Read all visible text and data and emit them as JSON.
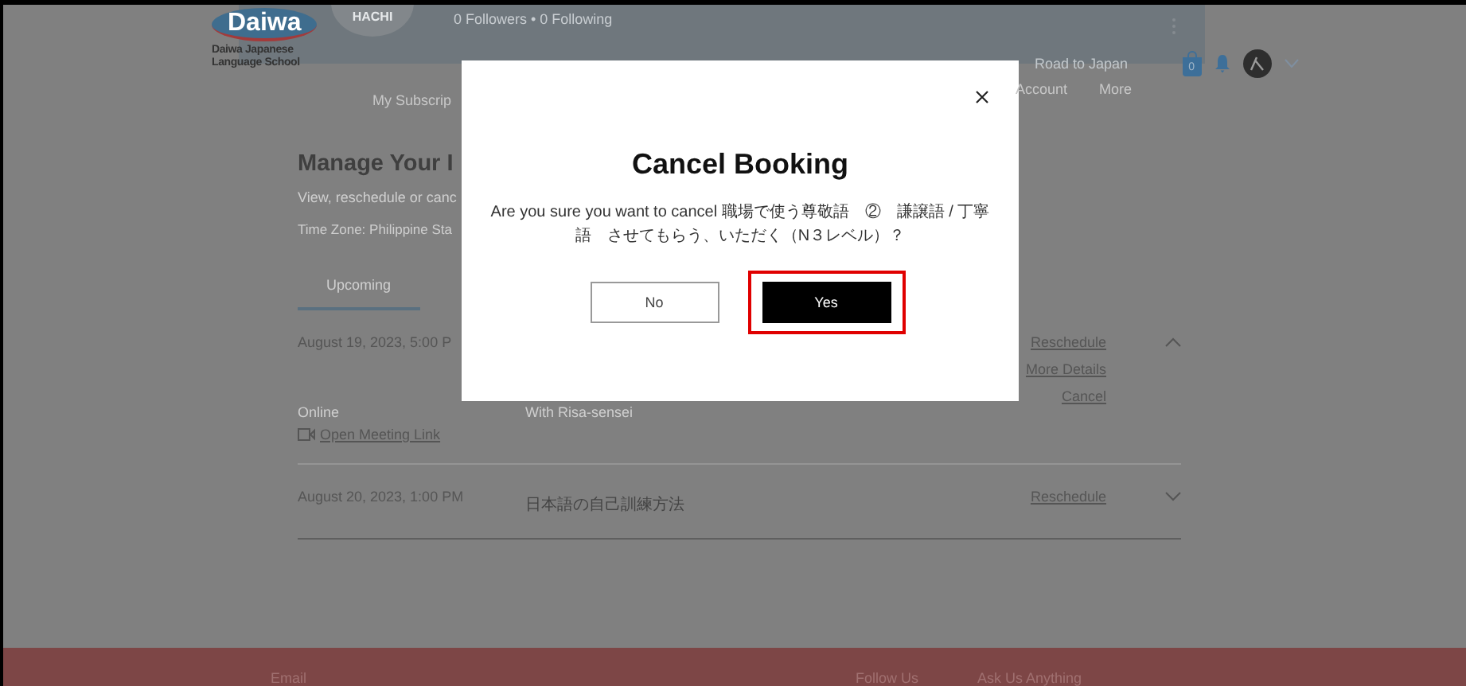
{
  "profile_banner": {
    "avatar_text": "HACHI",
    "stats": "0 Followers • 0 Following"
  },
  "logo": {
    "wordmark": "Daiwa",
    "subtitle_lines": [
      "Daiwa Japanese",
      "Language School"
    ]
  },
  "nav": {
    "top_items": [
      "Road to Japan"
    ],
    "bottom_left": [
      "My Subscrip"
    ],
    "bottom_right": [
      "Account",
      "More"
    ],
    "cart_count": "0"
  },
  "page": {
    "title": "Manage Your I",
    "subtitle": "View, reschedule or canc",
    "time_zone": "Time Zone: Philippine Sta",
    "tabs": [
      {
        "label": "Upcoming",
        "selected": true
      }
    ]
  },
  "bookings": [
    {
      "date": "August 19, 2023, 5:00 P",
      "actions": [
        "Reschedule",
        "More Details",
        "Cancel"
      ],
      "expanded": true,
      "location": "Online",
      "teacher": "With Risa-sensei",
      "meeting_link": "Open Meeting Link"
    },
    {
      "date": "August 20, 2023, 1:00 PM",
      "title": "日本語の自己訓練方法",
      "actions": [
        "Reschedule"
      ],
      "expanded": false
    }
  ],
  "dialog": {
    "title": "Cancel Booking",
    "message": "Are you sure you want to cancel 職場で使う尊敬語　②　謙譲語 / 丁寧語　させてもらう、いただく（N３レベル）？",
    "buttons": [
      {
        "label": "No",
        "kind": "secondary",
        "highlighted": false
      },
      {
        "label": "Yes",
        "kind": "primary",
        "highlighted": true
      }
    ]
  },
  "footer": {
    "columns": [
      "Email",
      "Follow Us",
      "Ask Us Anything"
    ]
  }
}
